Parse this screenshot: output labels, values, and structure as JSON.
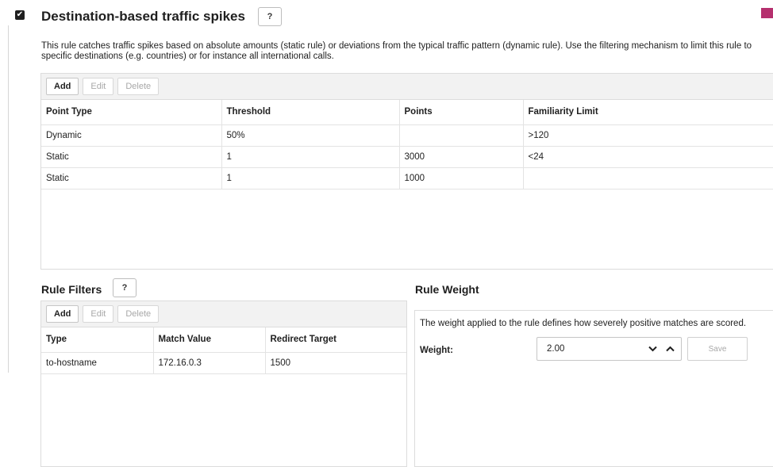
{
  "header": {
    "title": "Destination-based traffic spikes",
    "help_label": "?",
    "enabled_mark": "✔",
    "description": "This rule catches traffic spikes based on absolute amounts (static rule) or deviations from the typical traffic pattern (dynamic rule). Use the filtering mechanism to limit this rule to specific destinations (e.g. countries) or for instance all international calls."
  },
  "points_table": {
    "toolbar": {
      "add": "Add",
      "edit": "Edit",
      "delete": "Delete"
    },
    "columns": [
      "Point Type",
      "Threshold",
      "Points",
      "Familiarity Limit"
    ],
    "rows": [
      [
        "Dynamic",
        "50%",
        "",
        ">120"
      ],
      [
        "Static",
        "1",
        "3000",
        "<24"
      ],
      [
        "Static",
        "1",
        "1000",
        ""
      ]
    ]
  },
  "rule_filters": {
    "title": "Rule Filters",
    "help_label": "?",
    "toolbar": {
      "add": "Add",
      "edit": "Edit",
      "delete": "Delete"
    },
    "columns": [
      "Type",
      "Match Value",
      "Redirect Target"
    ],
    "rows": [
      [
        "to-hostname",
        "172.16.0.3",
        "1500"
      ]
    ]
  },
  "rule_weight": {
    "title": "Rule Weight",
    "description": "The weight applied to the rule defines how severely positive matches are scored.",
    "label": "Weight:",
    "value": "2.00",
    "save_label": "Save"
  },
  "colors": {
    "accent": "#b5306e",
    "toolbar_bg": "#f2f2f2",
    "border": "#dcdcdc"
  },
  "icons": {
    "checkbox": "checkbox-checked-icon",
    "decrement": "chevron-down-icon",
    "increment": "chevron-up-icon"
  }
}
